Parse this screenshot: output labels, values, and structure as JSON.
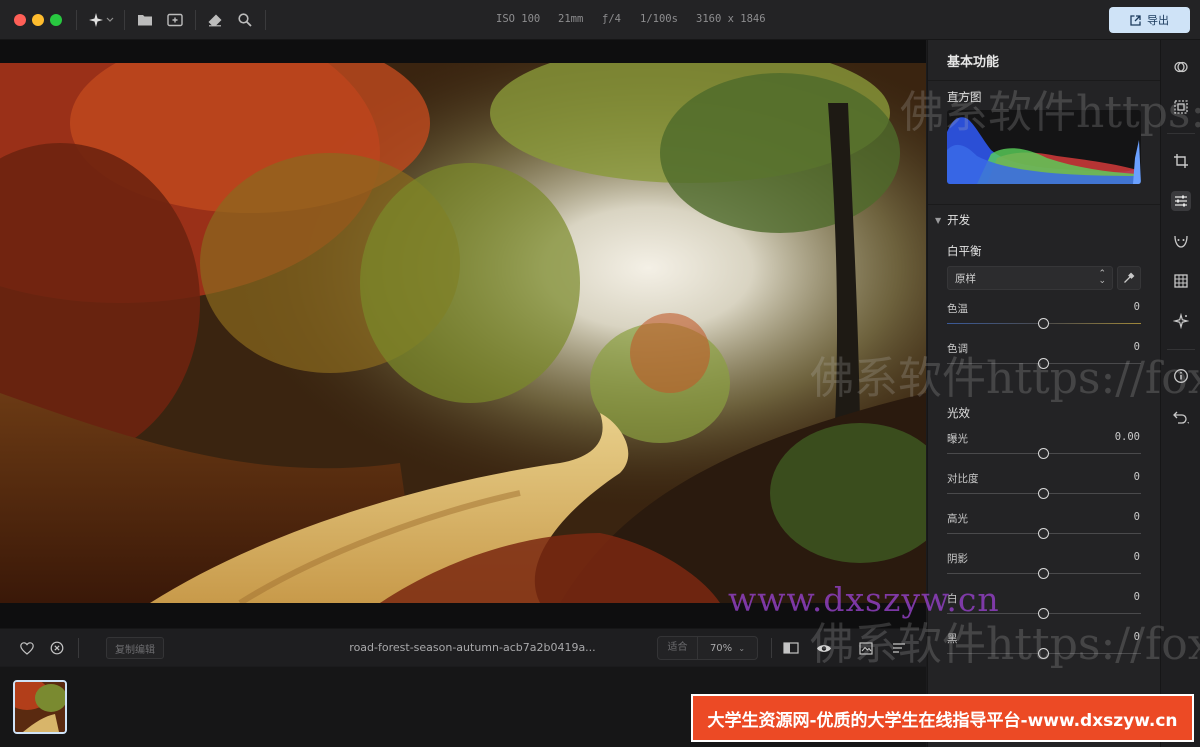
{
  "toolbar": {
    "meta": [
      "ISO 100",
      "21mm",
      "ƒ/4",
      "1/100s",
      "3160 x 1846"
    ],
    "export_label": "导出"
  },
  "bottombar": {
    "copy_edits_label": "复制编辑",
    "filename": "road-forest-season-autumn-acb7a2b0419a...",
    "zoom_fit_label": "适合",
    "zoom_value": "70%"
  },
  "panel": {
    "title": "基本功能",
    "histogram_label": "直方图",
    "develop_label": "开发",
    "white_balance": {
      "label": "白平衡",
      "selected": "原样",
      "temperature": {
        "label": "色温",
        "value": "0",
        "level": 0.5
      },
      "tint": {
        "label": "色调",
        "value": "0",
        "level": 0.5
      }
    },
    "light": {
      "label": "光效",
      "exposure": {
        "label": "曝光",
        "value": "0.00",
        "level": 0.5
      },
      "contrast": {
        "label": "对比度",
        "value": "0",
        "level": 0.5
      },
      "highlights": {
        "label": "高光",
        "value": "0",
        "level": 0.5
      },
      "shadows": {
        "label": "阴影",
        "value": "0",
        "level": 0.5
      },
      "whites": {
        "label": "白",
        "value": "0",
        "level": 0.5
      },
      "blacks": {
        "label": "黑",
        "value": "0",
        "level": 0.5
      }
    }
  },
  "watermarks": {
    "line1": "佛系软件https://fox",
    "line2": "佛系软件https://fox",
    "line3": "佛系软件https://fox",
    "url": "www.dxszyw.cn",
    "banner": "大学生资源网-优质的大学生在线指导平台-www.dxszyw.cn"
  },
  "colors": {
    "accent": "#cfe3f7",
    "banner": "#ec4a25",
    "close": "#fe5f57",
    "minimize": "#febc2e",
    "maximize": "#28c840"
  }
}
